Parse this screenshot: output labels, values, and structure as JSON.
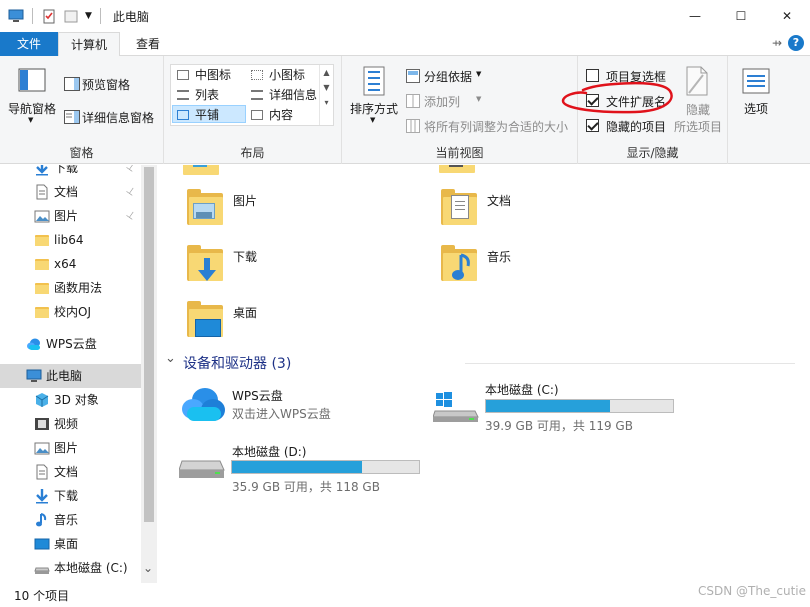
{
  "window": {
    "title": "此电脑",
    "minimize_glyph": "—",
    "maximize_glyph": "☐",
    "close_glyph": "✕"
  },
  "tabs": {
    "file": "文件",
    "computer": "计算机",
    "view": "查看",
    "expand_glyph": "⇸",
    "help_glyph": "?"
  },
  "ribbon": {
    "panes": {
      "nav_pane_label": "导航窗格",
      "preview_pane_label": "预览窗格",
      "details_pane_label": "详细信息窗格",
      "group_label": "窗格"
    },
    "layout": {
      "items": [
        "中图标",
        "小图标",
        "列表",
        "详细信息",
        "平铺",
        "内容"
      ],
      "selected": "平铺",
      "group_label": "布局"
    },
    "current_view": {
      "sort_label": "排序方式",
      "group_by_label": "分组依据",
      "add_column_label": "添加列",
      "size_columns_label": "将所有列调整为合适的大小",
      "group_label": "当前视图"
    },
    "show_hide": {
      "item_checkboxes_label": "项目复选框",
      "item_checkboxes_checked": false,
      "file_extensions_label": "文件扩展名",
      "file_extensions_checked": true,
      "hidden_items_label": "隐藏的项目",
      "hidden_items_checked": true,
      "hide_selected_label": "隐藏",
      "hide_selected_label2": "所选项目",
      "group_label": "显示/隐藏"
    },
    "options_label": "选项",
    "annotation_color": "#e0121b"
  },
  "nav": {
    "items": [
      {
        "label": "下载",
        "icon": "download-icon",
        "pinned": true
      },
      {
        "label": "文档",
        "icon": "document-icon",
        "pinned": true
      },
      {
        "label": "图片",
        "icon": "picture-icon",
        "pinned": true
      },
      {
        "label": "lib64",
        "icon": "folder-icon",
        "pinned": false
      },
      {
        "label": "x64",
        "icon": "folder-icon",
        "pinned": false
      },
      {
        "label": "函数用法",
        "icon": "folder-icon",
        "pinned": false
      },
      {
        "label": "校内OJ",
        "icon": "folder-icon",
        "pinned": false
      },
      {
        "label": "WPS云盘",
        "icon": "cloud-icon",
        "pinned": false
      },
      {
        "label": "此电脑",
        "icon": "computer-icon",
        "pinned": false
      },
      {
        "label": "3D 对象",
        "icon": "3d-objects-icon",
        "pinned": false
      },
      {
        "label": "视频",
        "icon": "video-icon",
        "pinned": false
      },
      {
        "label": "图片",
        "icon": "picture-icon",
        "pinned": false
      },
      {
        "label": "文档",
        "icon": "document-icon",
        "pinned": false
      },
      {
        "label": "下载",
        "icon": "download-icon",
        "pinned": false
      },
      {
        "label": "音乐",
        "icon": "music-icon",
        "pinned": false
      },
      {
        "label": "桌面",
        "icon": "desktop-icon",
        "pinned": false
      },
      {
        "label": "本地磁盘 (C:)",
        "icon": "drive-icon",
        "pinned": false
      }
    ],
    "pin_glyph": "📌",
    "scroll_down_glyph": "⌄"
  },
  "content": {
    "folders": [
      {
        "label": "图片",
        "icon": "pictures-folder-icon"
      },
      {
        "label": "文档",
        "icon": "documents-folder-icon"
      },
      {
        "label": "下载",
        "icon": "downloads-folder-icon"
      },
      {
        "label": "音乐",
        "icon": "music-folder-icon"
      },
      {
        "label": "桌面",
        "icon": "desktop-folder-icon"
      }
    ],
    "devices_section": "设备和驱动器 (3)",
    "section_chevron": "⌄",
    "drives": [
      {
        "name": "WPS云盘",
        "subtitle": "双击进入WPS云盘",
        "icon": "wps-cloud-icon"
      },
      {
        "name": "本地磁盘 (C:)",
        "free": "39.9 GB 可用，共 119 GB",
        "used_fraction": 0.665,
        "icon": "windows-drive-icon"
      },
      {
        "name": "本地磁盘 (D:)",
        "free": "35.9 GB 可用，共 118 GB",
        "used_fraction": 0.696,
        "icon": "drive-icon"
      }
    ]
  },
  "status": {
    "count": "10 个项目",
    "watermark": "CSDN @The_cutie"
  }
}
